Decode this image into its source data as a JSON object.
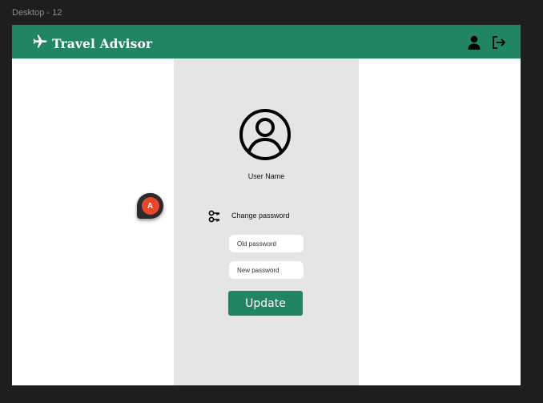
{
  "canvas": {
    "frame_label": "Desktop - 12"
  },
  "header": {
    "brand_icon": "airplane-icon",
    "brand_title": "Travel Advisor",
    "profile_icon": "user-icon",
    "logout_icon": "logout-icon",
    "color": "#218464"
  },
  "profile": {
    "avatar_icon": "user-circle-icon",
    "user_name": "User Name",
    "change_password_icon": "key-icon",
    "change_password_label": "Change password",
    "old_password_placeholder": "Old password",
    "new_password_placeholder": "New password",
    "update_label": "Update",
    "panel_color": "#e5e5e5"
  },
  "comment": {
    "initial": "A",
    "color": "#e8462a"
  }
}
